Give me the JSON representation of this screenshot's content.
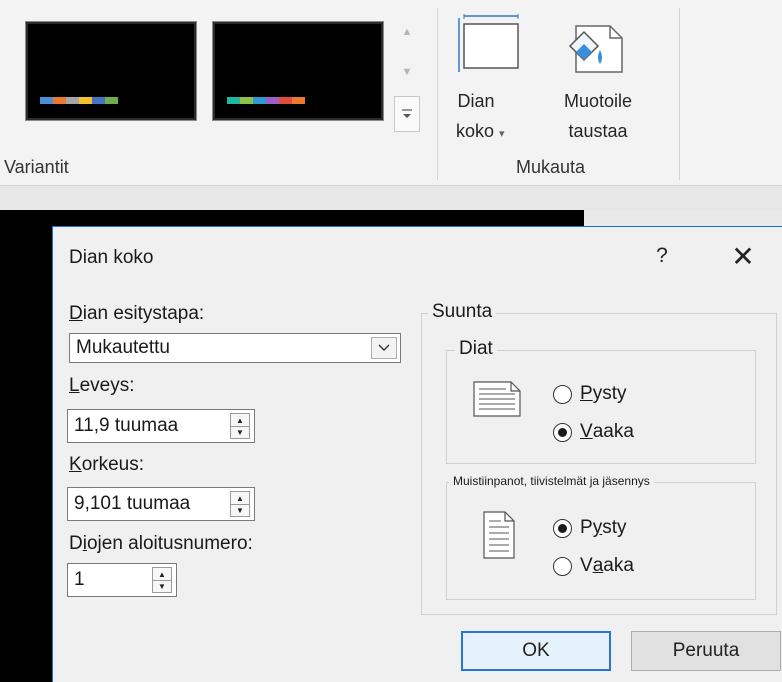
{
  "ribbon": {
    "variants_label": "Variantit",
    "slide_size_line1": "Dian",
    "slide_size_line2": "koko",
    "slide_size_caret": "▾",
    "format_bg_line1": "Muotoile",
    "format_bg_line2": "taustaa",
    "customize_label": "Mukauta",
    "theme_variants": [
      {
        "bars": [
          "#4a90d9",
          "#e8792d",
          "#a5a5a5",
          "#f2c12e",
          "#4472c4",
          "#70ad47"
        ]
      },
      {
        "bars": [
          "#1fb79f",
          "#8bc34a",
          "#2c9ad6",
          "#9c5fc5",
          "#e04b3e",
          "#e8792d"
        ]
      }
    ]
  },
  "dialog": {
    "title": "Dian koko",
    "help": "?",
    "close": "✕",
    "slide_format_label_first": "D",
    "slide_format_label_rest": "ian esitystapa:",
    "slide_format_value": "Mukautettu",
    "width_label_first": "L",
    "width_label_rest": "eveys:",
    "width_value": "11,9 tuumaa",
    "height_label_first": "K",
    "height_label_rest": "orkeus:",
    "height_value": "9,101 tuumaa",
    "start_label_pre": "D",
    "start_label_u": "i",
    "start_label_rest": "ojen aloitusnumero:",
    "start_value": "1",
    "orientation_title": "Suunta",
    "slides_group_title": "Diat",
    "slides_portrait_first": "P",
    "slides_portrait_rest": "ysty",
    "slides_landscape_first": "V",
    "slides_landscape_rest": "aaka",
    "slides_selected": "Vaaka",
    "notes_group_title": "Muistiinpanot, tiivistelmät ja jäsennys",
    "notes_portrait_pre": "P",
    "notes_portrait_u": "y",
    "notes_portrait_rest": "sty",
    "notes_landscape_pre": "V",
    "notes_landscape_u": "a",
    "notes_landscape_rest": "aka",
    "notes_selected": "Pysty",
    "ok_label": "OK",
    "cancel_label": "Peruuta"
  }
}
